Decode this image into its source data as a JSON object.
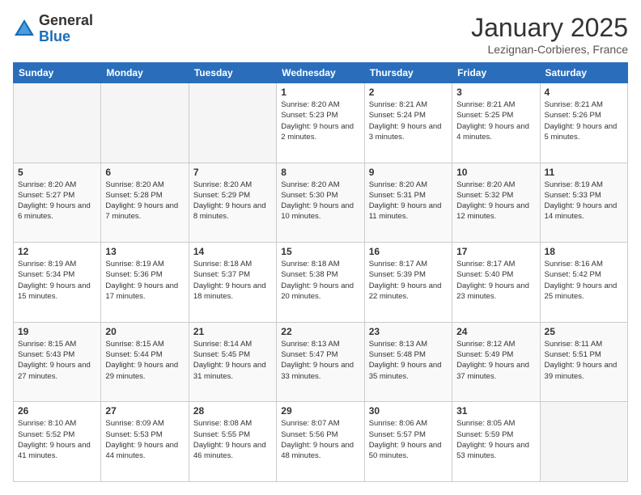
{
  "header": {
    "logo_general": "General",
    "logo_blue": "Blue",
    "month_title": "January 2025",
    "location": "Lezignan-Corbieres, France"
  },
  "days_of_week": [
    "Sunday",
    "Monday",
    "Tuesday",
    "Wednesday",
    "Thursday",
    "Friday",
    "Saturday"
  ],
  "weeks": [
    [
      {
        "day": "",
        "sunrise": "",
        "sunset": "",
        "daylight": "",
        "empty": true
      },
      {
        "day": "",
        "sunrise": "",
        "sunset": "",
        "daylight": "",
        "empty": true
      },
      {
        "day": "",
        "sunrise": "",
        "sunset": "",
        "daylight": "",
        "empty": true
      },
      {
        "day": "1",
        "sunrise": "Sunrise: 8:20 AM",
        "sunset": "Sunset: 5:23 PM",
        "daylight": "Daylight: 9 hours and 2 minutes."
      },
      {
        "day": "2",
        "sunrise": "Sunrise: 8:21 AM",
        "sunset": "Sunset: 5:24 PM",
        "daylight": "Daylight: 9 hours and 3 minutes."
      },
      {
        "day": "3",
        "sunrise": "Sunrise: 8:21 AM",
        "sunset": "Sunset: 5:25 PM",
        "daylight": "Daylight: 9 hours and 4 minutes."
      },
      {
        "day": "4",
        "sunrise": "Sunrise: 8:21 AM",
        "sunset": "Sunset: 5:26 PM",
        "daylight": "Daylight: 9 hours and 5 minutes."
      }
    ],
    [
      {
        "day": "5",
        "sunrise": "Sunrise: 8:20 AM",
        "sunset": "Sunset: 5:27 PM",
        "daylight": "Daylight: 9 hours and 6 minutes."
      },
      {
        "day": "6",
        "sunrise": "Sunrise: 8:20 AM",
        "sunset": "Sunset: 5:28 PM",
        "daylight": "Daylight: 9 hours and 7 minutes."
      },
      {
        "day": "7",
        "sunrise": "Sunrise: 8:20 AM",
        "sunset": "Sunset: 5:29 PM",
        "daylight": "Daylight: 9 hours and 8 minutes."
      },
      {
        "day": "8",
        "sunrise": "Sunrise: 8:20 AM",
        "sunset": "Sunset: 5:30 PM",
        "daylight": "Daylight: 9 hours and 10 minutes."
      },
      {
        "day": "9",
        "sunrise": "Sunrise: 8:20 AM",
        "sunset": "Sunset: 5:31 PM",
        "daylight": "Daylight: 9 hours and 11 minutes."
      },
      {
        "day": "10",
        "sunrise": "Sunrise: 8:20 AM",
        "sunset": "Sunset: 5:32 PM",
        "daylight": "Daylight: 9 hours and 12 minutes."
      },
      {
        "day": "11",
        "sunrise": "Sunrise: 8:19 AM",
        "sunset": "Sunset: 5:33 PM",
        "daylight": "Daylight: 9 hours and 14 minutes."
      }
    ],
    [
      {
        "day": "12",
        "sunrise": "Sunrise: 8:19 AM",
        "sunset": "Sunset: 5:34 PM",
        "daylight": "Daylight: 9 hours and 15 minutes."
      },
      {
        "day": "13",
        "sunrise": "Sunrise: 8:19 AM",
        "sunset": "Sunset: 5:36 PM",
        "daylight": "Daylight: 9 hours and 17 minutes."
      },
      {
        "day": "14",
        "sunrise": "Sunrise: 8:18 AM",
        "sunset": "Sunset: 5:37 PM",
        "daylight": "Daylight: 9 hours and 18 minutes."
      },
      {
        "day": "15",
        "sunrise": "Sunrise: 8:18 AM",
        "sunset": "Sunset: 5:38 PM",
        "daylight": "Daylight: 9 hours and 20 minutes."
      },
      {
        "day": "16",
        "sunrise": "Sunrise: 8:17 AM",
        "sunset": "Sunset: 5:39 PM",
        "daylight": "Daylight: 9 hours and 22 minutes."
      },
      {
        "day": "17",
        "sunrise": "Sunrise: 8:17 AM",
        "sunset": "Sunset: 5:40 PM",
        "daylight": "Daylight: 9 hours and 23 minutes."
      },
      {
        "day": "18",
        "sunrise": "Sunrise: 8:16 AM",
        "sunset": "Sunset: 5:42 PM",
        "daylight": "Daylight: 9 hours and 25 minutes."
      }
    ],
    [
      {
        "day": "19",
        "sunrise": "Sunrise: 8:15 AM",
        "sunset": "Sunset: 5:43 PM",
        "daylight": "Daylight: 9 hours and 27 minutes."
      },
      {
        "day": "20",
        "sunrise": "Sunrise: 8:15 AM",
        "sunset": "Sunset: 5:44 PM",
        "daylight": "Daylight: 9 hours and 29 minutes."
      },
      {
        "day": "21",
        "sunrise": "Sunrise: 8:14 AM",
        "sunset": "Sunset: 5:45 PM",
        "daylight": "Daylight: 9 hours and 31 minutes."
      },
      {
        "day": "22",
        "sunrise": "Sunrise: 8:13 AM",
        "sunset": "Sunset: 5:47 PM",
        "daylight": "Daylight: 9 hours and 33 minutes."
      },
      {
        "day": "23",
        "sunrise": "Sunrise: 8:13 AM",
        "sunset": "Sunset: 5:48 PM",
        "daylight": "Daylight: 9 hours and 35 minutes."
      },
      {
        "day": "24",
        "sunrise": "Sunrise: 8:12 AM",
        "sunset": "Sunset: 5:49 PM",
        "daylight": "Daylight: 9 hours and 37 minutes."
      },
      {
        "day": "25",
        "sunrise": "Sunrise: 8:11 AM",
        "sunset": "Sunset: 5:51 PM",
        "daylight": "Daylight: 9 hours and 39 minutes."
      }
    ],
    [
      {
        "day": "26",
        "sunrise": "Sunrise: 8:10 AM",
        "sunset": "Sunset: 5:52 PM",
        "daylight": "Daylight: 9 hours and 41 minutes."
      },
      {
        "day": "27",
        "sunrise": "Sunrise: 8:09 AM",
        "sunset": "Sunset: 5:53 PM",
        "daylight": "Daylight: 9 hours and 44 minutes."
      },
      {
        "day": "28",
        "sunrise": "Sunrise: 8:08 AM",
        "sunset": "Sunset: 5:55 PM",
        "daylight": "Daylight: 9 hours and 46 minutes."
      },
      {
        "day": "29",
        "sunrise": "Sunrise: 8:07 AM",
        "sunset": "Sunset: 5:56 PM",
        "daylight": "Daylight: 9 hours and 48 minutes."
      },
      {
        "day": "30",
        "sunrise": "Sunrise: 8:06 AM",
        "sunset": "Sunset: 5:57 PM",
        "daylight": "Daylight: 9 hours and 50 minutes."
      },
      {
        "day": "31",
        "sunrise": "Sunrise: 8:05 AM",
        "sunset": "Sunset: 5:59 PM",
        "daylight": "Daylight: 9 hours and 53 minutes."
      },
      {
        "day": "",
        "sunrise": "",
        "sunset": "",
        "daylight": "",
        "empty": true
      }
    ]
  ]
}
